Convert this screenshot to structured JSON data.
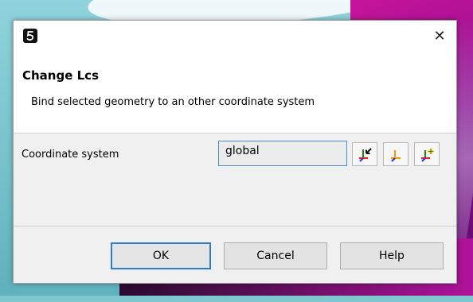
{
  "dialog": {
    "title": "Change Lcs",
    "description": "Bind selected geometry to an other coordinate system",
    "close_glyph": "✕",
    "app_icon": "app-swirl-icon"
  },
  "form": {
    "coordinate_system_label": "Coordinate system",
    "coordinate_system_value": "global",
    "buttons": [
      {
        "name": "pick-coordinate-system-button",
        "icon": "axes-pick-icon",
        "accent": "#111111"
      },
      {
        "name": "show-coordinate-system-button",
        "icon": "axes-orange-icon",
        "accent": "#f39c12"
      },
      {
        "name": "new-coordinate-system-button",
        "icon": "axes-new-icon",
        "accent": "#f1e000"
      }
    ]
  },
  "footer": {
    "ok_label": "OK",
    "cancel_label": "Cancel",
    "help_label": "Help"
  },
  "colors": {
    "axis_x": "#e52121",
    "axis_y": "#2a7f1f",
    "axis_z": "#1f43d6",
    "focus": "#2f7bd1"
  }
}
